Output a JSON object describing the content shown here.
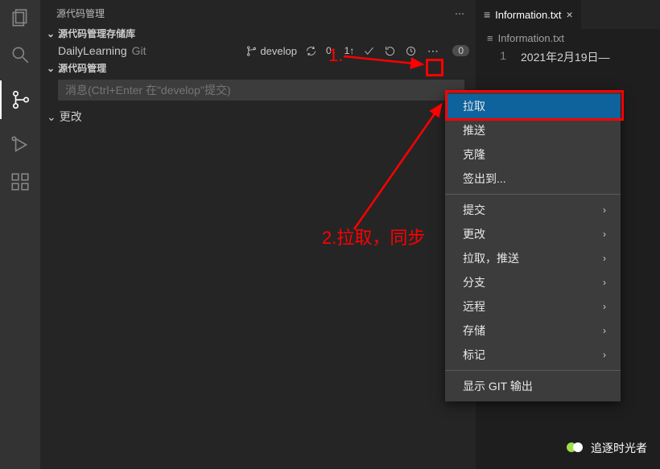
{
  "activity": {
    "items": [
      "files-icon",
      "search-icon",
      "source-control-icon",
      "debug-icon",
      "extensions-icon"
    ],
    "activeIndex": 2
  },
  "sidebar": {
    "title": "源代码管理",
    "sections": {
      "repos": {
        "label": "源代码管理存储库"
      },
      "scm": {
        "label": "源代码管理"
      }
    },
    "repo": {
      "name": "DailyLearning",
      "vcs": "Git",
      "branch": "develop",
      "syncDown": "0↓",
      "syncUp": "1↑",
      "badge": "0"
    },
    "commitPlaceholder": "消息(Ctrl+Enter 在\"develop\"提交)",
    "changesLabel": "更改"
  },
  "editor": {
    "tab": {
      "filename": "Information.txt"
    },
    "breadcrumb": "Information.txt",
    "lineNumber": "1",
    "lineContent": "2021年2月19日—"
  },
  "contextMenu": {
    "items": [
      {
        "label": "拉取",
        "hasSub": false,
        "selected": true
      },
      {
        "label": "推送",
        "hasSub": false
      },
      {
        "label": "克隆",
        "hasSub": false
      },
      {
        "label": "签出到...",
        "hasSub": false
      },
      {
        "sep": true
      },
      {
        "label": "提交",
        "hasSub": true
      },
      {
        "label": "更改",
        "hasSub": true
      },
      {
        "label": "拉取，推送",
        "hasSub": true
      },
      {
        "label": "分支",
        "hasSub": true
      },
      {
        "label": "远程",
        "hasSub": true
      },
      {
        "label": "存储",
        "hasSub": true
      },
      {
        "label": "标记",
        "hasSub": true
      },
      {
        "sep": true
      },
      {
        "label": "显示 GIT 输出",
        "hasSub": false
      }
    ]
  },
  "annotations": {
    "step1": "1.",
    "step2": "2.拉取，同步"
  },
  "watermark": {
    "text": "追逐时光者"
  }
}
